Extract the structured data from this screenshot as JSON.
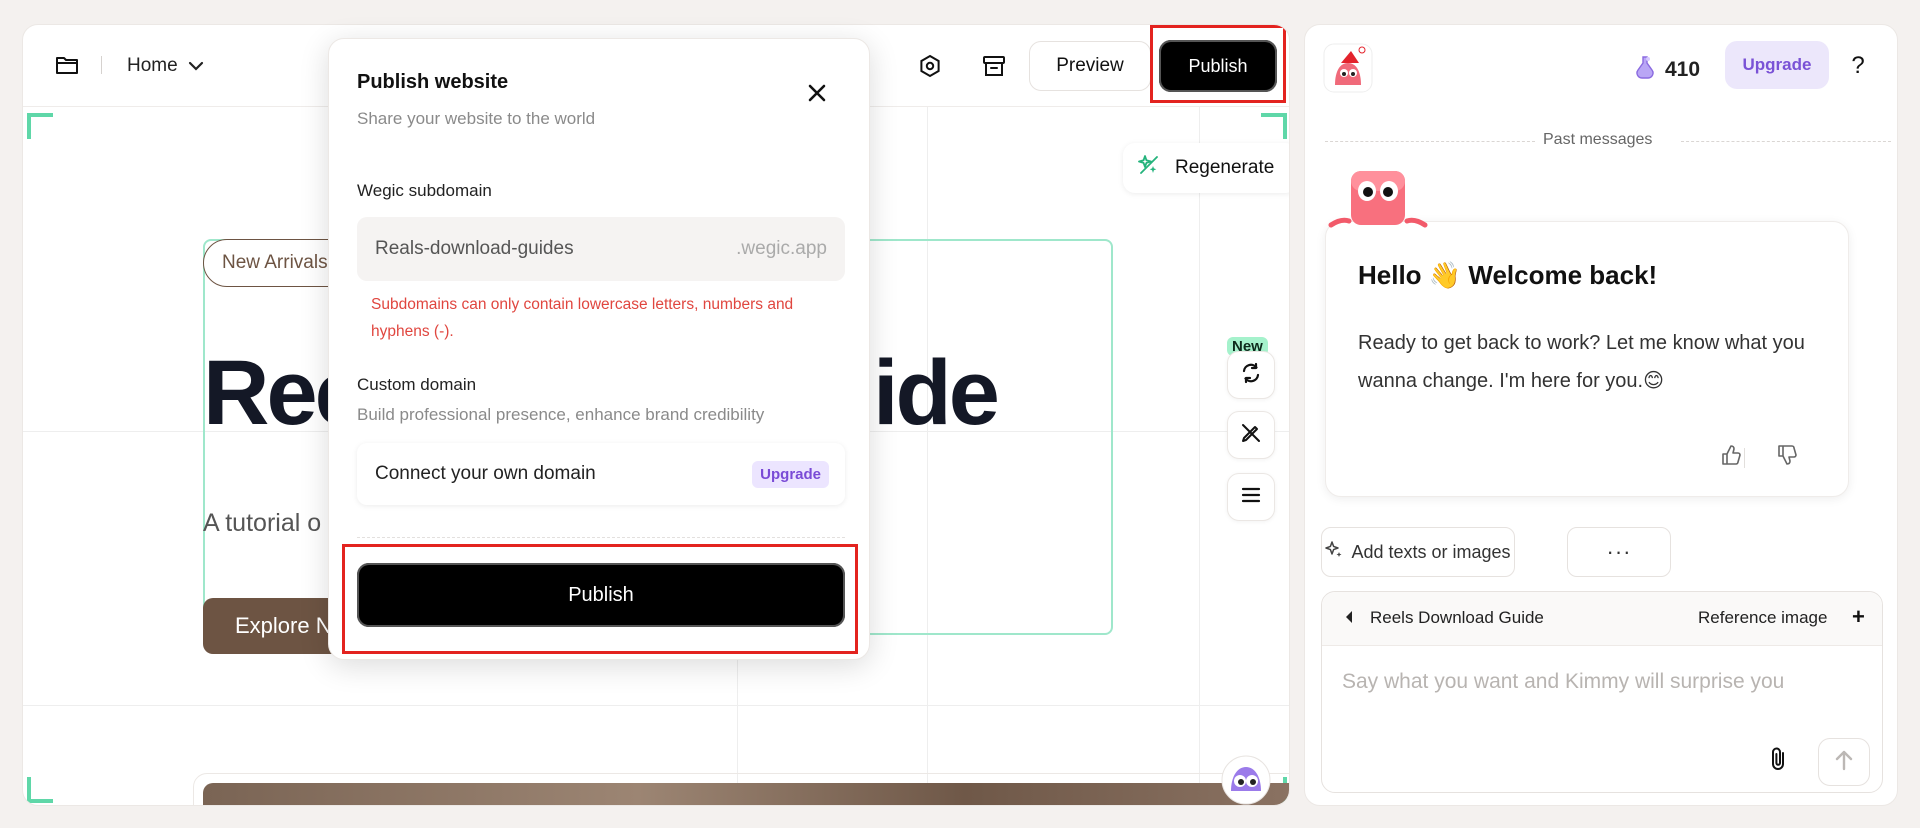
{
  "editor": {
    "breadcrumb": "Home",
    "preview_label": "Preview",
    "publish_label": "Publish",
    "regenerate_label": "Regenerate",
    "new_badge": "New",
    "canvas": {
      "tag": "New Arrivals",
      "title_left": "Ree",
      "title_right": "ide",
      "subtitle": "A tutorial o",
      "cta": "Explore N"
    }
  },
  "modal": {
    "title": "Publish website",
    "subtitle": "Share your website to the world",
    "subdomain_label": "Wegic subdomain",
    "subdomain_value": "Reals-download-guides",
    "subdomain_suffix": ".wegic.app",
    "error": "Subdomains can only contain lowercase letters, numbers and hyphens (-).",
    "custom_label": "Custom domain",
    "custom_sub": "Build professional presence, enhance brand credibility",
    "connect_label": "Connect your own domain",
    "upgrade_tag": "Upgrade",
    "publish_label": "Publish"
  },
  "chat": {
    "credits": "410",
    "upgrade_label": "Upgrade",
    "help_label": "?",
    "past_messages": "Past messages",
    "welcome_title": "Hello 👋 Welcome back!",
    "welcome_body": "Ready to get back to work? Let me know what you wanna change. I'm here for you.😊",
    "add_chip": "Add texts or images",
    "more_chip": "···",
    "ref_name": "Reels Download Guide",
    "ref_image": "Reference image",
    "ref_add": "+",
    "input_placeholder": "Say what you want and Kimmy will surprise you"
  },
  "colors": {
    "accent_green": "#5fd7a8",
    "brand_brown": "#6d5443",
    "error_red": "#e0463f",
    "upgrade_purple": "#7a52d6",
    "highlight_red": "#e3231f"
  }
}
